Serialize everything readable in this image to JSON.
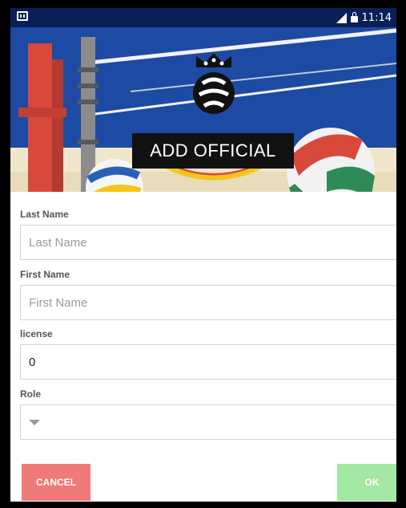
{
  "status_bar": {
    "time": "11:14",
    "network": "LTE"
  },
  "banner": {
    "title": "ADD OFFICIAL"
  },
  "form": {
    "last_name": {
      "label": "Last Name",
      "placeholder": "Last Name",
      "value": ""
    },
    "first_name": {
      "label": "First Name",
      "placeholder": "First Name",
      "value": ""
    },
    "license": {
      "label": "license",
      "value": "0"
    },
    "role": {
      "label": "Role",
      "value": ""
    }
  },
  "actions": {
    "cancel_label": "CANCEL",
    "ok_label": "OK"
  },
  "colors": {
    "status_bar": "#0b1f57",
    "cancel": "#f07a7a",
    "ok": "#a3e8a3"
  }
}
